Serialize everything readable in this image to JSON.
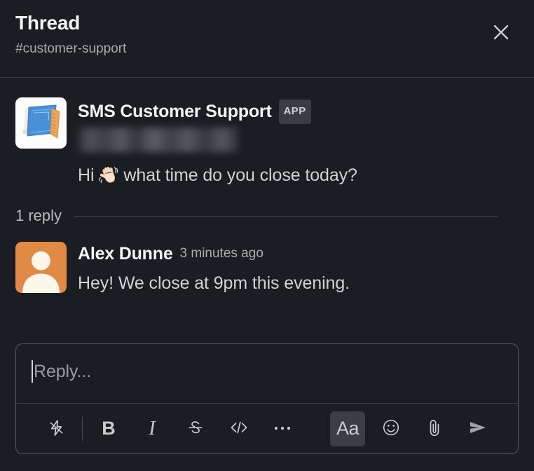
{
  "header": {
    "title": "Thread",
    "channel": "#customer-support",
    "close_label": "Close",
    "close_icon": "close-icon"
  },
  "thread": {
    "root_message": {
      "sender": "SMS Customer Support",
      "badge": "APP",
      "avatar_icon": "blueprint-app-avatar",
      "redacted_subtext": "",
      "text_before_emoji": "Hi ",
      "emoji": "waving-hand-emoji",
      "text_after_emoji": " what time do you close today?"
    },
    "divider": {
      "reply_count_label": "1 reply"
    },
    "replies": [
      {
        "sender": "Alex Dunne",
        "timestamp": "3 minutes ago",
        "avatar_icon": "person-avatar",
        "text": "Hey! We close at 9pm this evening."
      }
    ]
  },
  "composer": {
    "placeholder": "Reply...",
    "value": "",
    "toolbar": {
      "shortcuts_label": "Shortcuts",
      "bold_label": "B",
      "italic_label": "I",
      "strikethrough_label": "S",
      "code_label": "</>",
      "more_label": "•••",
      "formatting_label": "Aa",
      "emoji_label": "Emoji",
      "attach_label": "Attach",
      "send_label": "Send",
      "formatting_active": true
    }
  },
  "colors": {
    "background": "#1a1d21",
    "text_primary": "#d1d2d3",
    "text_heading": "#f4f5f6",
    "text_muted": "#ababad",
    "border": "#3a3f46",
    "composer_border": "#565a60",
    "badge_bg": "#3a3d42",
    "active_bg": "#3b3f45",
    "avatar_orange": "#e08a45",
    "avatar_blue": "#4a90d9"
  }
}
